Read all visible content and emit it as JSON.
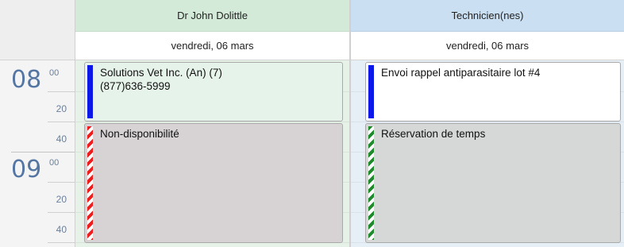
{
  "columns": [
    {
      "name": "Dr John Dolittle",
      "date": "vendredi, 06 mars"
    },
    {
      "name": "Technicien(nes)",
      "date": "vendredi, 06 mars"
    }
  ],
  "time_labels": {
    "hour_08": "08",
    "hour_09": "09",
    "m_08_00": "00",
    "m_08_20": "20",
    "m_08_40": "40",
    "m_09_00": "00",
    "m_09_20": "20",
    "m_09_40": "40"
  },
  "appointments": [
    {
      "column": "Dr John Dolittle",
      "text": "Solutions Vet Inc. (An) (7)\n(877)636-5999",
      "start": "08:00",
      "end": "08:40",
      "status_bar": "solid-blue",
      "color": "#0a17e8"
    },
    {
      "column": "Technicien(nes)",
      "text": "Envoi rappel antiparasitaire lot #4",
      "start": "08:00",
      "end": "08:40",
      "status_bar": "solid-blue",
      "color": "#0a17e8"
    },
    {
      "column": "Dr John Dolittle",
      "text": "Non-disponibilité",
      "start": "08:40",
      "end": "10:00",
      "status_bar": "striped-red",
      "color": "#ee1c1c"
    },
    {
      "column": "Technicien(nes)",
      "text": "Réservation de temps",
      "start": "08:40",
      "end": "10:00",
      "status_bar": "striped-green",
      "color": "#1e8a2c"
    }
  ]
}
